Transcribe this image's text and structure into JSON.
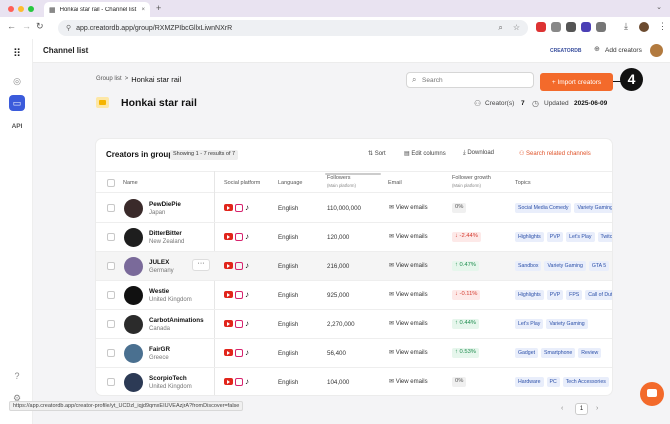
{
  "browser": {
    "tab_title": "Honkai star rail - Channel list",
    "tab_close": "×",
    "new_tab": "+",
    "url": "app.creatordb.app/group/RXMZPIbcGllxLiwnNXrR"
  },
  "header": {
    "app_title": "Channel list",
    "badge": "CREATORDB",
    "add_creators": "Add creators"
  },
  "sidebar": {
    "api_label": "API"
  },
  "group": {
    "breadcrumb_parent": "Group list",
    "breadcrumb_sep": ">",
    "breadcrumb_current": "Honkai star rail",
    "title": "Honkai star rail",
    "search_placeholder": "Search",
    "import_button": "+ Import creators",
    "step_badge": "4",
    "creators_label": "Creator(s)",
    "creators_count": "7",
    "updated_label": "Updated",
    "updated_date": "2025-06-09"
  },
  "table": {
    "heading": "Creators in group",
    "showing": "Showing 1 - 7 results of 7",
    "actions": {
      "sort": "Sort",
      "edit_columns": "Edit columns",
      "download": "Download",
      "related": "Search related channels"
    },
    "columns": {
      "name": "Name",
      "social": "Social platform",
      "language": "Language",
      "followers": "Followers",
      "followers_sub": "(Main platform)",
      "email": "Email",
      "growth": "Follower growth",
      "growth_sub": "(Main platform)",
      "topics": "Topics"
    },
    "row_menu": "···",
    "rows": [
      {
        "name": "PewDiePie",
        "country": "Japan",
        "language": "English",
        "followers": "110,000,000",
        "email": "View emails",
        "growth": "0%",
        "growth_dir": "zero",
        "topics": [
          "Social Media Comedy",
          "Variety Gaming"
        ]
      },
      {
        "name": "DitterBitter",
        "country": "New Zealand",
        "language": "English",
        "followers": "120,000",
        "email": "View emails",
        "growth": "↓ -2.44%",
        "growth_dir": "down",
        "topics": [
          "Highlights",
          "PVP",
          "Let's Play",
          "Twitch"
        ]
      },
      {
        "name": "JULEX",
        "country": "Germany",
        "language": "English",
        "followers": "216,000",
        "email": "View emails",
        "growth": "↑ 0.47%",
        "growth_dir": "up",
        "topics": [
          "Sandbox",
          "Variety Gaming",
          "GTA 5"
        ]
      },
      {
        "name": "Westie",
        "country": "United Kingdom",
        "language": "English",
        "followers": "925,000",
        "email": "View emails",
        "growth": "↓ -0.11%",
        "growth_dir": "down",
        "topics": [
          "Highlights",
          "PVP",
          "FPS",
          "Call of Duty"
        ]
      },
      {
        "name": "CarbotAnimations",
        "country": "Canada",
        "language": "English",
        "followers": "2,270,000",
        "email": "View emails",
        "growth": "↑ 0.44%",
        "growth_dir": "up",
        "topics": [
          "Let's Play",
          "Variety Gaming"
        ]
      },
      {
        "name": "FairGR",
        "country": "Greece",
        "language": "English",
        "followers": "56,400",
        "email": "View emails",
        "growth": "↑ 0.53%",
        "growth_dir": "up",
        "topics": [
          "Gadget",
          "Smartphone",
          "Review"
        ]
      },
      {
        "name": "ScorpioTech",
        "country": "United Kingdom",
        "language": "English",
        "followers": "104,000",
        "email": "View emails",
        "growth": "0%",
        "growth_dir": "zero",
        "topics": [
          "Hardware",
          "PC",
          "Tech Accessories"
        ]
      }
    ]
  },
  "pagination": {
    "current": "1"
  },
  "status_url": "https://app.creatordb.app/creator-profile/yt_UCDzl_iqjd9qmxEIUVEAzjrA?fromDiscover=false",
  "colors": {
    "accent": "#f36a2b",
    "folder": "#f5b400",
    "nav_active": "#3b5bdb"
  }
}
